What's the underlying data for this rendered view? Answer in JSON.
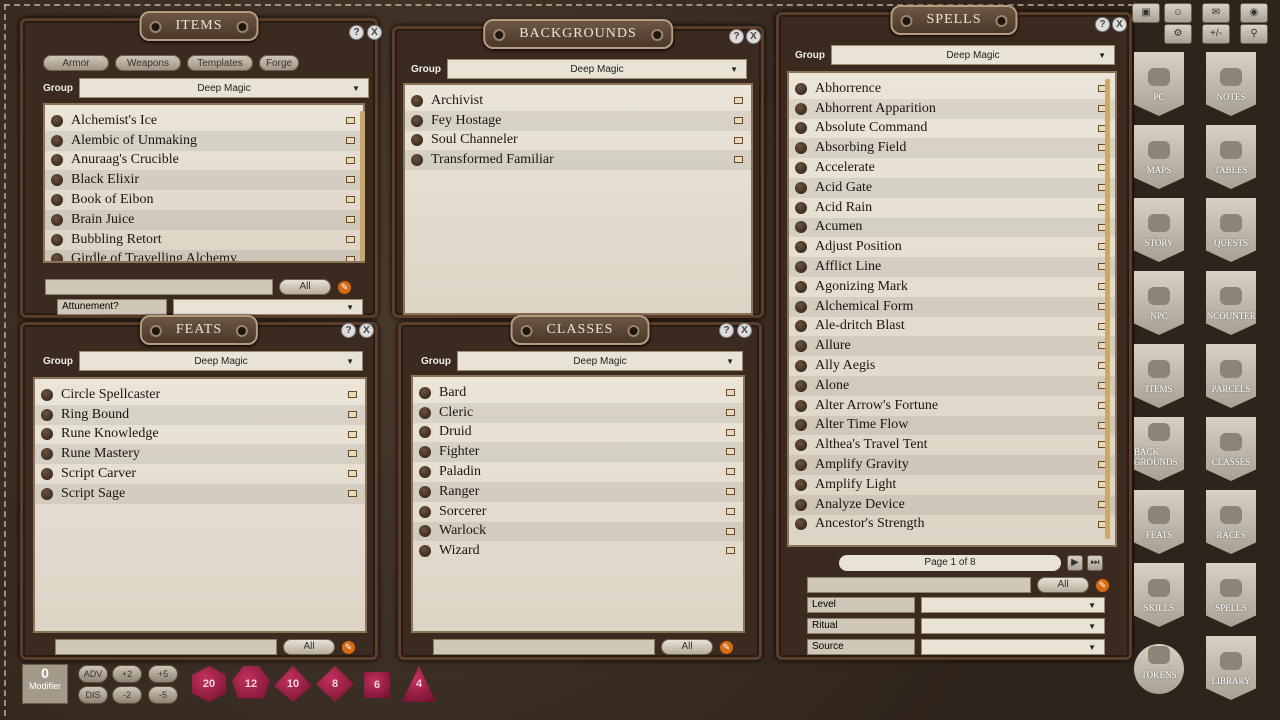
{
  "items": {
    "title": "ITEMS",
    "tabs": [
      "Armor",
      "Weapons",
      "Templates",
      "Forge"
    ],
    "group_label": "Group",
    "group_value": "Deep Magic",
    "list": [
      "Alchemist's Ice",
      "Alembic of Unmaking",
      "Anuraag's Crucible",
      "Black Elixir",
      "Book of Eibon",
      "Brain Juice",
      "Bubbling Retort",
      "Girdle of Travelling Alchemy"
    ],
    "all_label": "All",
    "attunement_label": "Attunement?"
  },
  "backgrounds": {
    "title": "BACKGROUNDS",
    "group_label": "Group",
    "group_value": "Deep Magic",
    "list": [
      "Archivist",
      "Fey Hostage",
      "Soul Channeler",
      "Transformed Familiar"
    ]
  },
  "spells": {
    "title": "SPELLS",
    "group_label": "Group",
    "group_value": "Deep Magic",
    "list": [
      "Abhorrence",
      "Abhorrent Apparition",
      "Absolute Command",
      "Absorbing Field",
      "Accelerate",
      "Acid Gate",
      "Acid Rain",
      "Acumen",
      "Adjust Position",
      "Afflict Line",
      "Agonizing Mark",
      "Alchemical Form",
      "Ale-dritch Blast",
      "Allure",
      "Ally Aegis",
      "Alone",
      "Alter Arrow's Fortune",
      "Alter Time Flow",
      "Althea's Travel Tent",
      "Amplify Gravity",
      "Amplify Light",
      "Analyze Device",
      "Ancestor's Strength"
    ],
    "page_text": "Page 1 of 8",
    "all_label": "All",
    "filters": [
      "Level",
      "Ritual",
      "Source"
    ]
  },
  "feats": {
    "title": "FEATS",
    "group_label": "Group",
    "group_value": "Deep Magic",
    "list": [
      "Circle Spellcaster",
      "Ring Bound",
      "Rune Knowledge",
      "Rune Mastery",
      "Script Carver",
      "Script Sage"
    ],
    "all_label": "All"
  },
  "classes": {
    "title": "CLASSES",
    "group_label": "Group",
    "group_value": "Deep Magic",
    "list": [
      "Bard",
      "Cleric",
      "Druid",
      "Fighter",
      "Paladin",
      "Ranger",
      "Sorcerer",
      "Warlock",
      "Wizard"
    ],
    "all_label": "All"
  },
  "sidebar": [
    "PC",
    "NOTES",
    "MAPS",
    "TABLES",
    "STORY",
    "QUESTS",
    "NPC",
    "ENCOUNTERS",
    "ITEMS",
    "PARCELS",
    "BACK GROUNDS",
    "CLASSES",
    "FEATS",
    "RACES",
    "SKILLS",
    "SPELLS",
    "TOKENS",
    "LIBRARY"
  ],
  "toolbar": {
    "modifier_value": "0",
    "modifier_label": "Modifier",
    "adv": "ADV",
    "dis": "DIS",
    "p2": "+2",
    "p5": "+5",
    "m2": "-2",
    "m5": "-5",
    "plusminus": "+/-"
  },
  "dice": [
    "20",
    "12",
    "10",
    "8",
    "6",
    "4"
  ],
  "help": "?",
  "close": "X"
}
